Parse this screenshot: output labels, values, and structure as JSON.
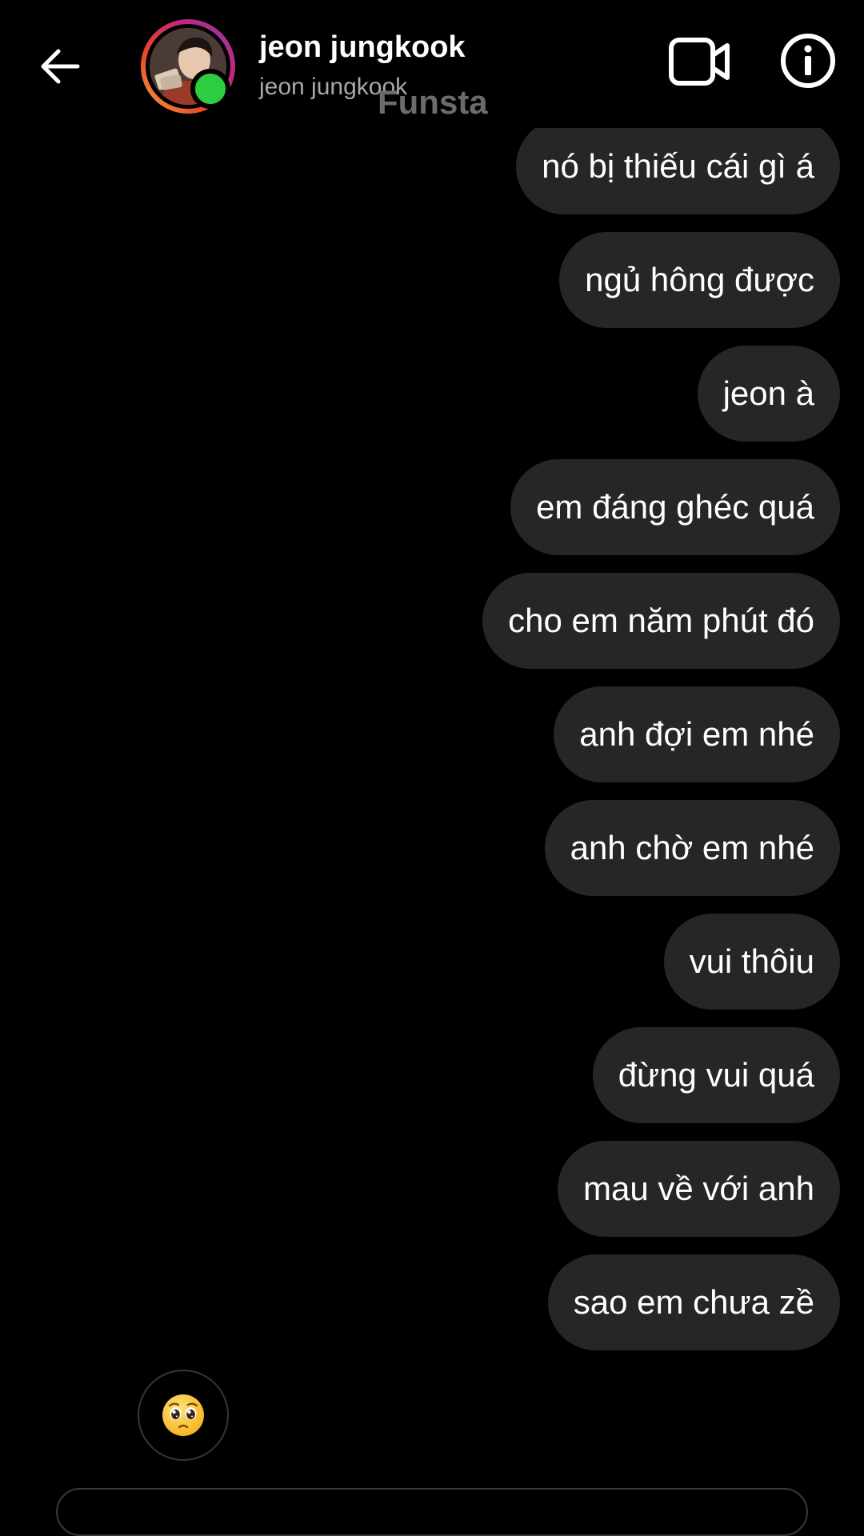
{
  "header": {
    "name": "jeon jungkook",
    "username": "jeon jungkook",
    "watermark": "Funsta",
    "icons": [
      "back-arrow-icon",
      "video-call-icon",
      "info-icon"
    ],
    "online_color": "#2ecc40"
  },
  "messages": [
    {
      "text": "nó bị thiếu cái gì á"
    },
    {
      "text": "ngủ hông được"
    },
    {
      "text": "jeon à"
    },
    {
      "text": "em đáng ghéc quá"
    },
    {
      "text": "cho em năm phút đó"
    },
    {
      "text": "anh đợi em nhé"
    },
    {
      "text": "anh chờ em nhé"
    },
    {
      "text": "vui thôiu"
    },
    {
      "text": "đừng vui quá"
    },
    {
      "text": "mau về với anh"
    },
    {
      "text": "sao em chưa zề"
    }
  ],
  "reaction": {
    "emoji": "pleading-face-icon"
  },
  "colors": {
    "background": "#000000",
    "bubble": "#262626",
    "text": "#ffffff",
    "secondary_text": "#a8a8a8"
  }
}
